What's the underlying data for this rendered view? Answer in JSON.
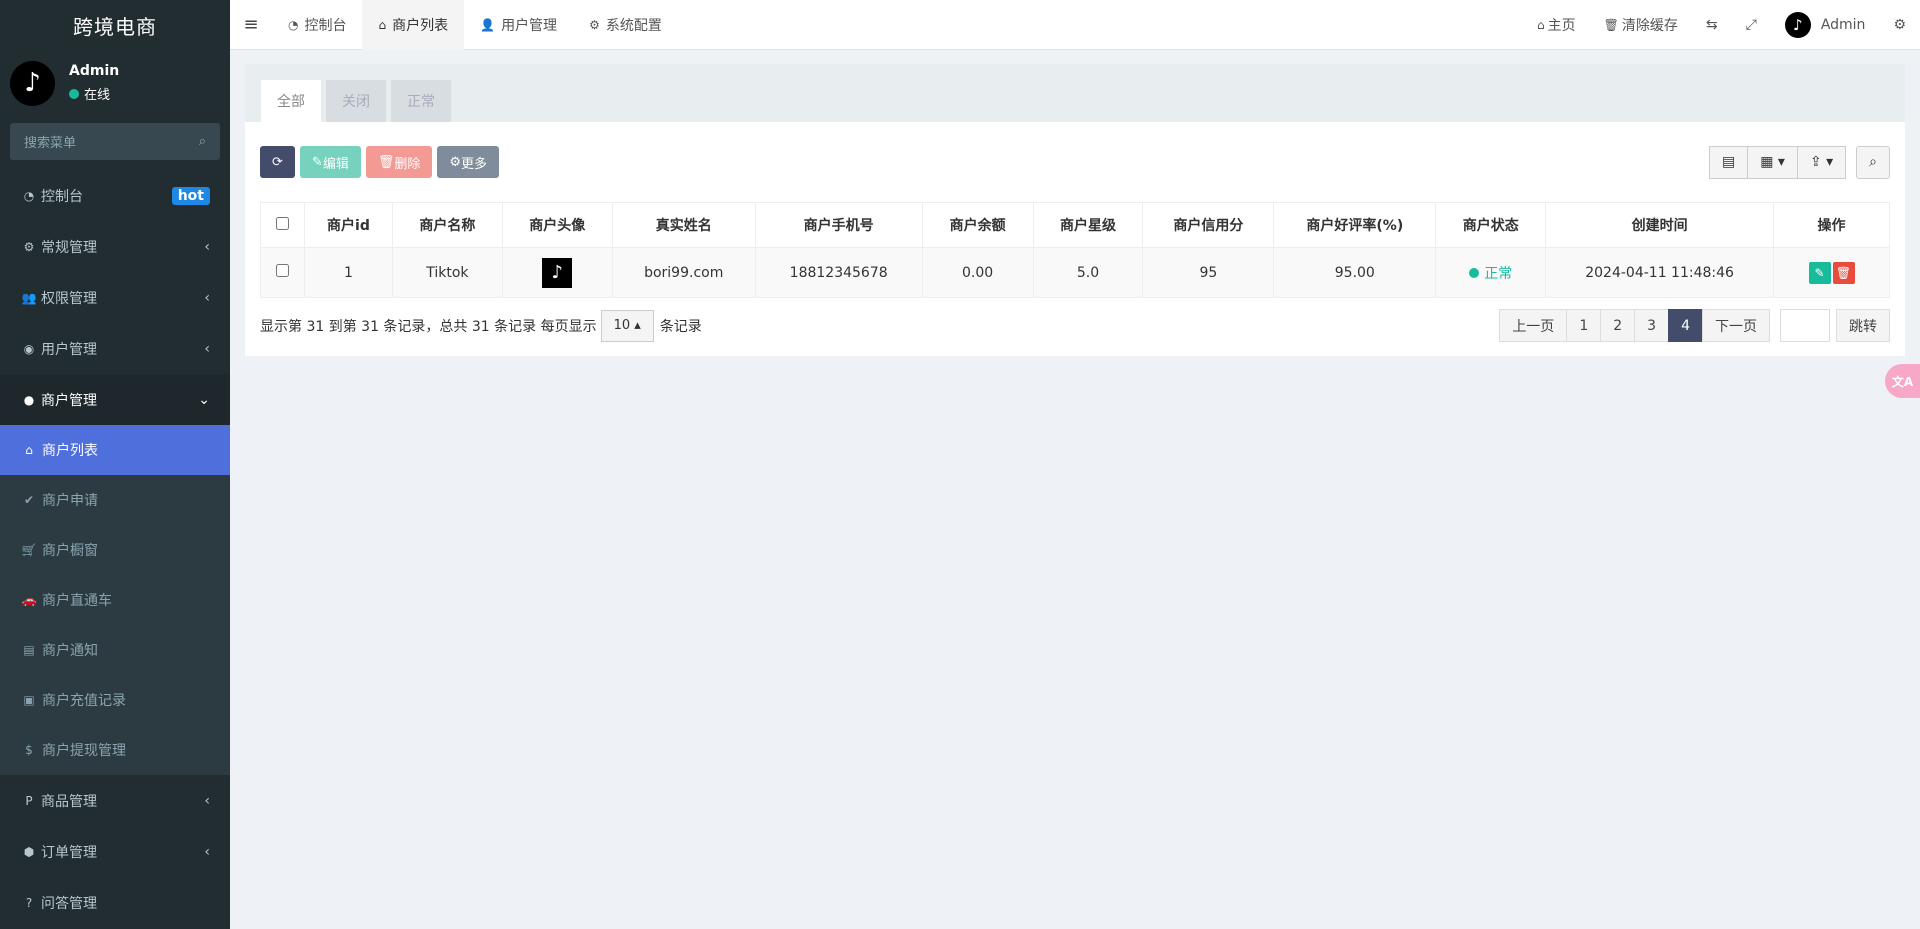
{
  "brand": {
    "title": "跨境电商"
  },
  "user": {
    "name": "Admin",
    "status": "在线",
    "avatar_glyph": "♪"
  },
  "search": {
    "placeholder": "搜索菜单"
  },
  "sidebar": {
    "items": [
      {
        "icon": "◔",
        "label": "控制台",
        "badge": "hot"
      },
      {
        "icon": "⚙",
        "label": "常规管理",
        "arrow": "‹"
      },
      {
        "icon": "👥",
        "label": "权限管理",
        "arrow": "‹"
      },
      {
        "icon": "◉",
        "label": "用户管理",
        "arrow": "‹"
      },
      {
        "icon": "",
        "label": "商户管理",
        "arrow": "⌄"
      }
    ],
    "sub_items": [
      {
        "icon": "⌂",
        "label": "商户列表"
      },
      {
        "icon": "✔",
        "label": "商户申请"
      },
      {
        "icon": "🛒",
        "label": "商户橱窗"
      },
      {
        "icon": "🚗",
        "label": "商户直通车"
      },
      {
        "icon": "▤",
        "label": "商户通知"
      },
      {
        "icon": "▣",
        "label": "商户充值记录"
      },
      {
        "icon": "$",
        "label": "商户提现管理"
      }
    ],
    "bottom_items": [
      {
        "icon": "P",
        "label": "商品管理",
        "arrow": "‹"
      },
      {
        "icon": "⬢",
        "label": "订单管理",
        "arrow": "‹"
      },
      {
        "icon": "?",
        "label": "问答管理"
      }
    ]
  },
  "topbar": {
    "tabs": [
      {
        "icon": "◔",
        "label": "控制台"
      },
      {
        "icon": "⌂",
        "label": "商户列表"
      },
      {
        "icon": "👤",
        "label": "用户管理"
      },
      {
        "icon": "⚙",
        "label": "系统配置"
      }
    ],
    "home": "主页",
    "clear_cache": "清除缓存",
    "admin": "Admin"
  },
  "filter_tabs": [
    "全部",
    "关闭",
    "正常"
  ],
  "toolbar": {
    "edit": "编辑",
    "delete": "删除",
    "more": "更多"
  },
  "table": {
    "headers": [
      "商户id",
      "商户名称",
      "商户头像",
      "真实姓名",
      "商户手机号",
      "商户余额",
      "商户星级",
      "商户信用分",
      "商户好评率(%)",
      "商户状态",
      "创建时间",
      "操作"
    ],
    "rows": [
      {
        "id": "1",
        "name": "Tiktok",
        "real_name": "bori99.com",
        "phone": "18812345678",
        "balance": "0.00",
        "stars": "5.0",
        "credit": "95",
        "rating": "95.00",
        "status": "正常",
        "created": "2024-04-11 11:48:46"
      }
    ]
  },
  "pagination": {
    "summary": "显示第 31 到第 31 条记录，总共 31 条记录 每页显示",
    "page_size": "10",
    "page_size_suffix": "条记录",
    "prev": "上一页",
    "pages": [
      "1",
      "2",
      "3",
      "4"
    ],
    "active": "4",
    "next": "下一页",
    "go": "跳转"
  },
  "float": {
    "label": "文A"
  },
  "colors": {
    "sidebar_bg": "#222d32",
    "active_blue": "#4f6fdc",
    "green": "#18bc9c",
    "dark_btn": "#444c6c"
  }
}
